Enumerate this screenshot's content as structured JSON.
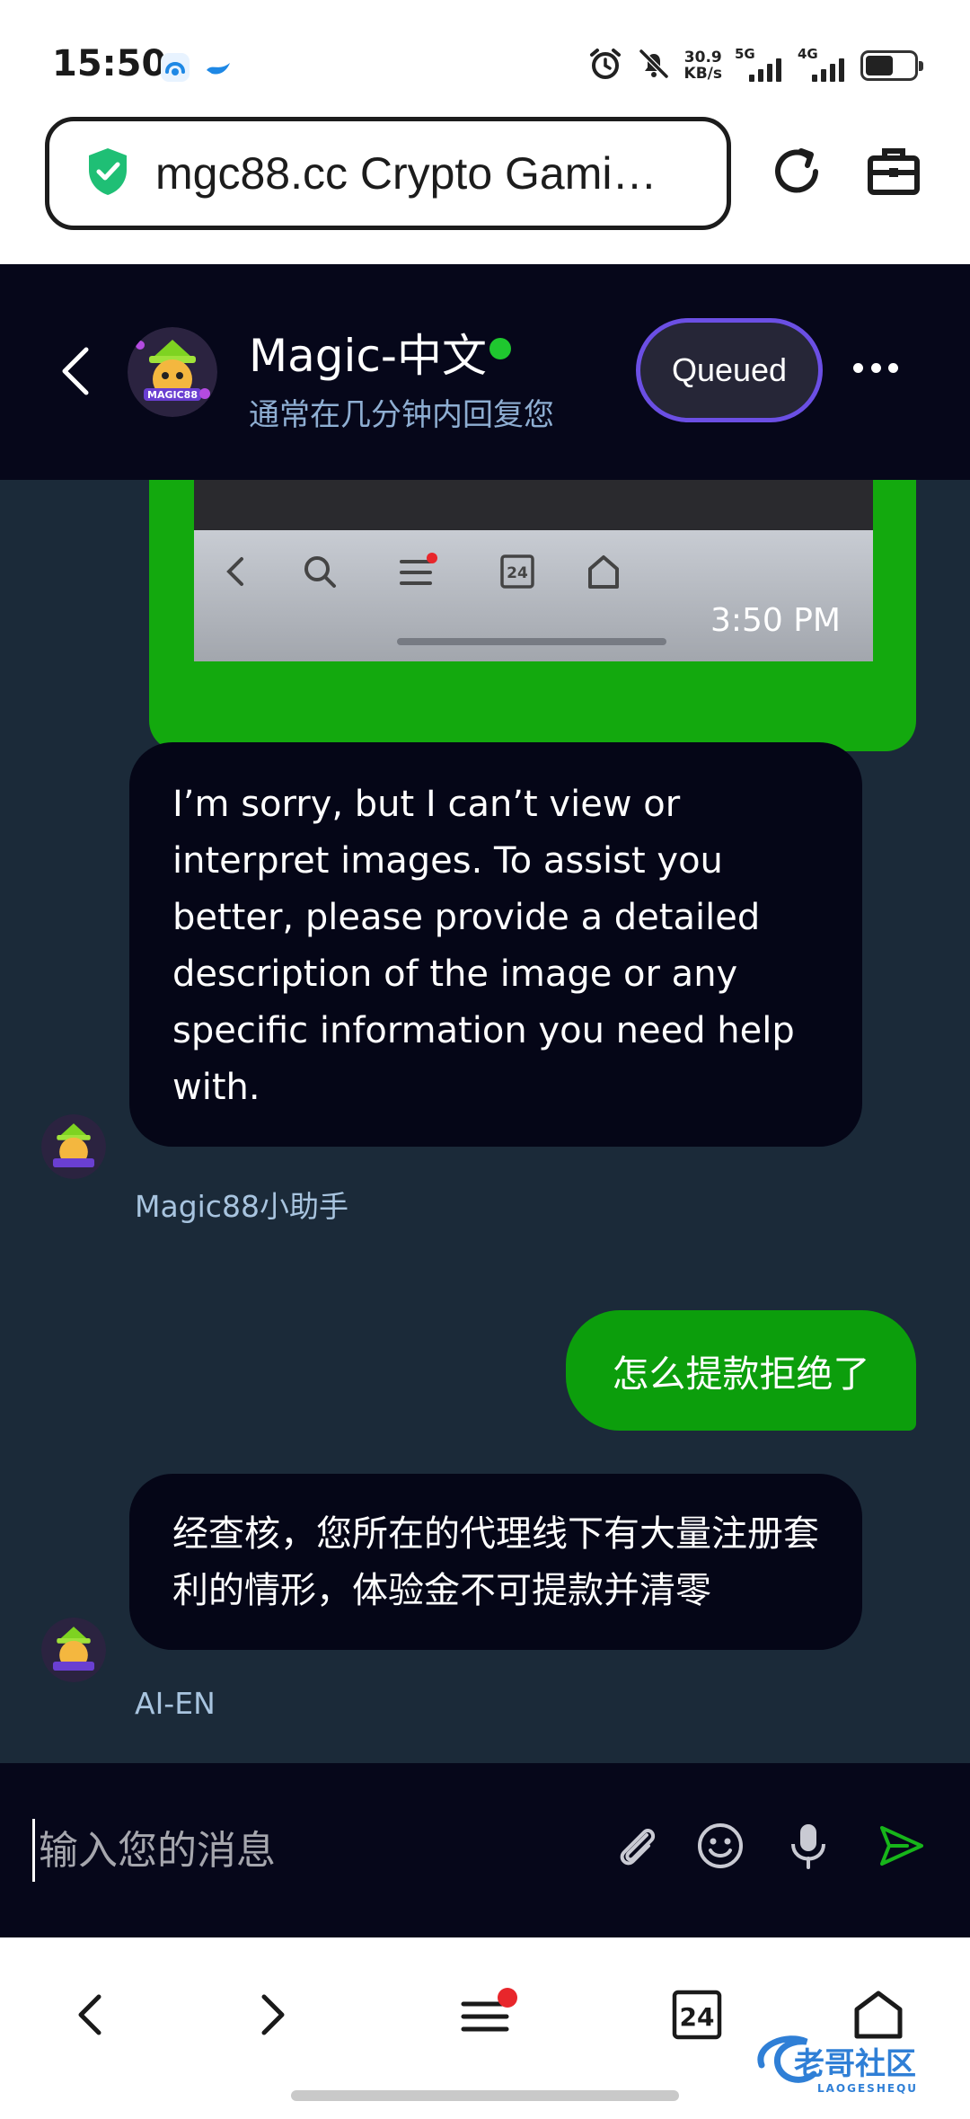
{
  "status_bar": {
    "time": "15:50",
    "net_speed_value": "30.9",
    "net_speed_unit": "KB/s",
    "signal1_label": "5G",
    "signal2_label": "4G",
    "icons": [
      "app-notification-icon",
      "bird-notification-icon",
      "alarm-icon",
      "mute-icon",
      "battery-icon"
    ]
  },
  "browser": {
    "url_display": "mgc88.cc Crypto Gami…",
    "secure_icon": "shield-check-icon",
    "reload_icon": "reload-icon",
    "toolbox_icon": "toolbox-icon"
  },
  "chat_header": {
    "agent_name": "Magic-中文",
    "status_color": "#1fc72f",
    "subtitle": "通常在几分钟内回复您",
    "queue_label": "Queued",
    "avatar_text": "MAGIC88"
  },
  "messages": {
    "image_message": {
      "time": "3:50 PM",
      "icons": [
        "back-icon",
        "search-icon",
        "menu-icon",
        "tabs-icon",
        "home-icon"
      ],
      "tab_count": "24"
    },
    "bot_reply_1": {
      "text": "I’m sorry, but I can’t view or interpret images. To assist you better, please provide a detailed description of the image or any specific information you need help with.",
      "sender": "Magic88小助手"
    },
    "user_message": {
      "text": "怎么提款拒绝了"
    },
    "bot_reply_2": {
      "text": "经查核，您所在的代理线下有大量注册套利的情形，体验金不可提款并清零",
      "sender": "AI-EN"
    }
  },
  "input_bar": {
    "placeholder": "输入您的消息",
    "icons": [
      "attach-icon",
      "emoji-icon",
      "microphone-icon",
      "send-icon"
    ]
  },
  "bottom_nav": {
    "tab_count": "24",
    "icons": [
      "back-icon",
      "forward-icon",
      "menu-icon",
      "tabs-icon",
      "home-icon"
    ]
  },
  "watermark": {
    "text": "老哥社区",
    "sub": "LAOGESHEQU"
  },
  "colors": {
    "header_bg": "#06071a",
    "chat_bg": "#1b2a39",
    "bubble_in": "#050617",
    "bubble_out": "#0c9e0c",
    "queue_border": "#6b4fe4",
    "sender_name": "#a8c4df"
  }
}
